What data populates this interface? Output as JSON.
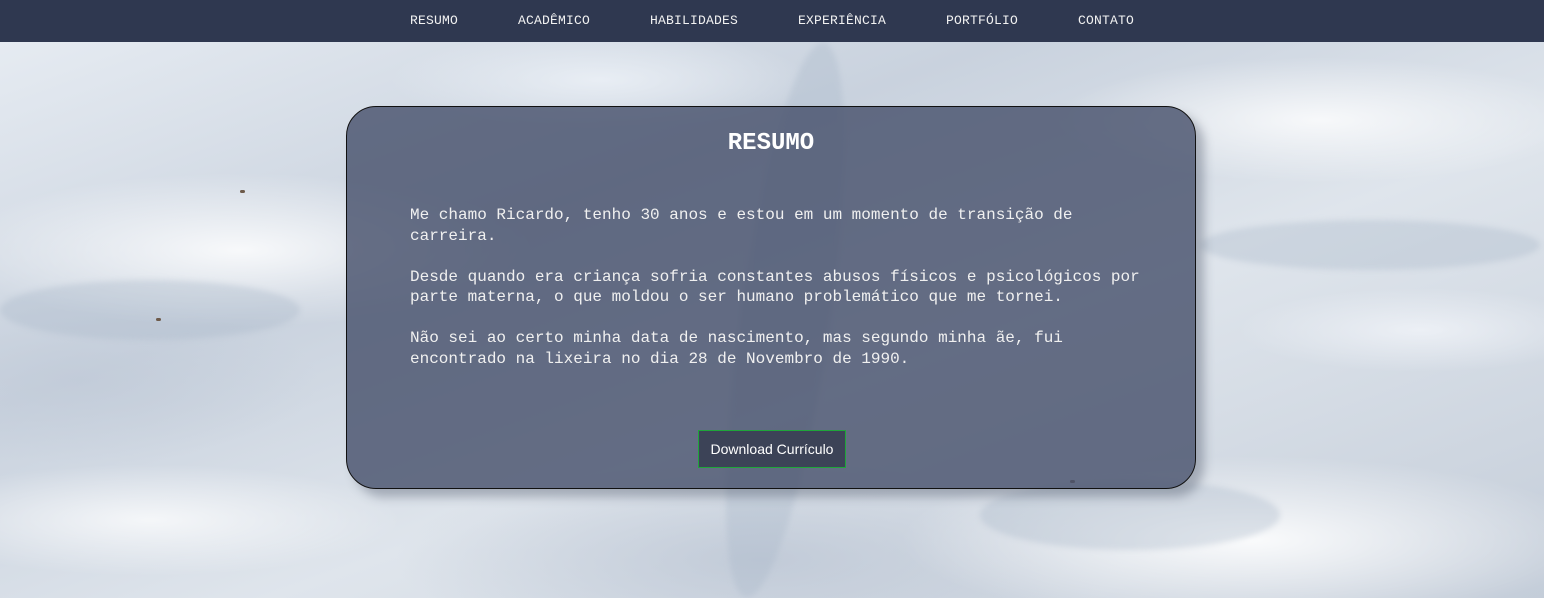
{
  "nav": {
    "items": [
      {
        "label": "RESUMO"
      },
      {
        "label": "ACADÊMICO"
      },
      {
        "label": "HABILIDADES"
      },
      {
        "label": "EXPERIÊNCIA"
      },
      {
        "label": "PORTFÓLIO"
      },
      {
        "label": "CONTATO"
      }
    ]
  },
  "resumo": {
    "title": "RESUMO",
    "paragraphs": [
      "Me chamo Ricardo, tenho 30 anos e estou em um momento de transição de carreira.",
      "Desde quando era criança sofria constantes abusos físicos e psicológicos por parte materna, o que moldou o ser humano problemático que me tornei.",
      "Não sei ao certo minha data de nascimento, mas segundo minha ãe, fui encontrado na lixeira no dia 28 de Novembro de 1990."
    ],
    "download_label": "Download Currículo"
  },
  "colors": {
    "navbar": "#2f3850",
    "card": "#48526c",
    "button_border": "#1fa53a"
  }
}
